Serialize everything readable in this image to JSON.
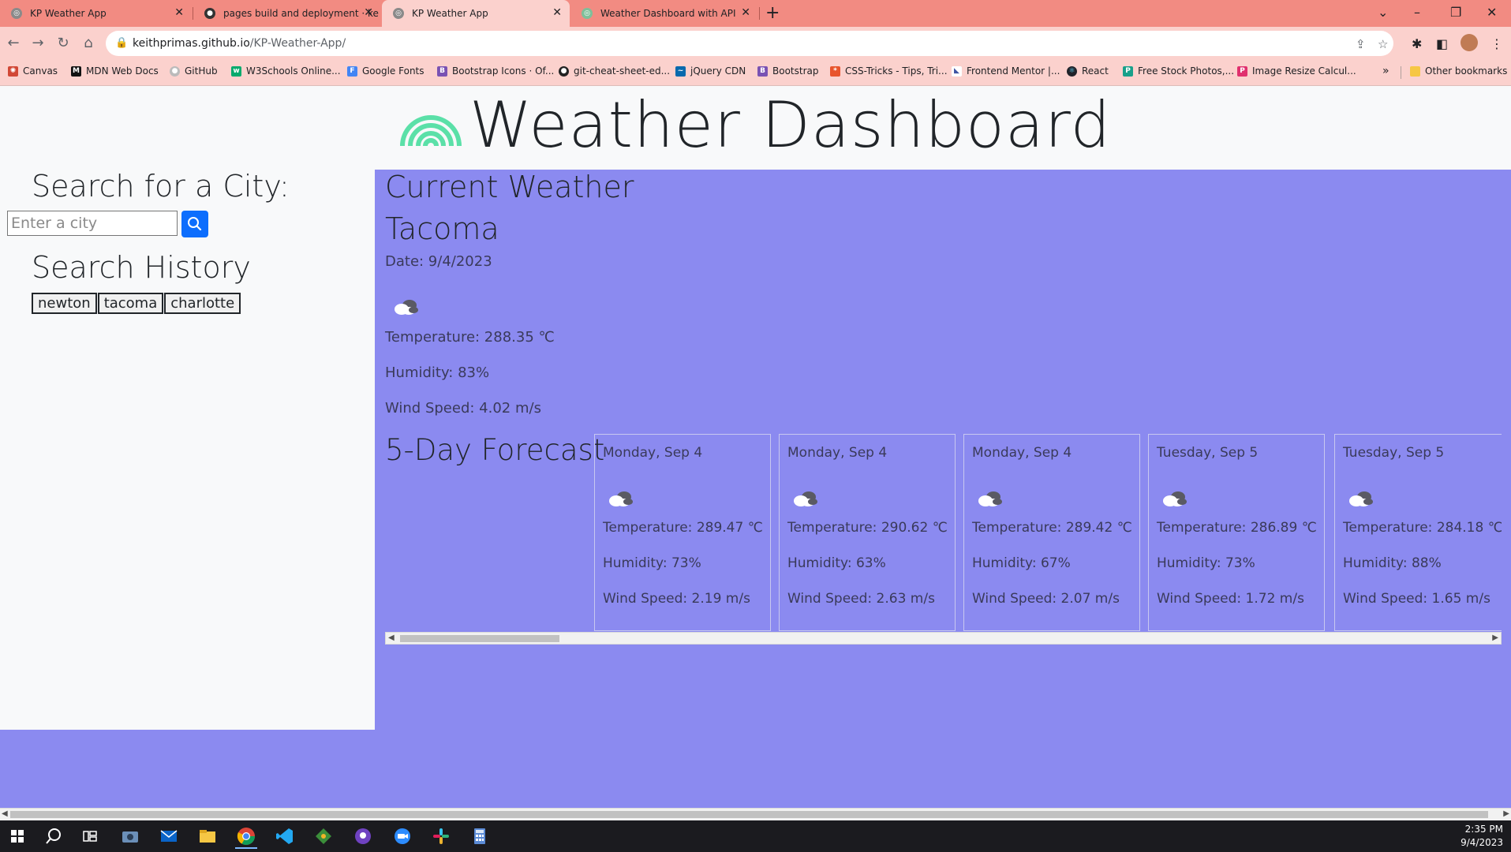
{
  "browser": {
    "tabs": [
      {
        "title": "KP Weather App",
        "active": false
      },
      {
        "title": "pages build and deployment · ke",
        "active": false
      },
      {
        "title": "KP Weather App",
        "active": true
      },
      {
        "title": "Weather Dashboard with API",
        "active": false
      }
    ],
    "address": {
      "host": "keithprimas.github.io",
      "path": "/KP-Weather-App/"
    },
    "bookmarks": [
      "Canvas",
      "MDN Web Docs",
      "GitHub",
      "W3Schools Online...",
      "Google Fonts",
      "Bootstrap Icons · Of...",
      "git-cheat-sheet-ed...",
      "jQuery CDN",
      "Bootstrap",
      "CSS-Tricks - Tips, Tri...",
      "Frontend Mentor |...",
      "React",
      "Free Stock Photos,...",
      "Image Resize Calcul..."
    ],
    "other_bookmarks": "Other bookmarks",
    "colors": {
      "tab_strip": "#f28b82",
      "toolbar": "#fbd1cd"
    }
  },
  "page": {
    "title": "Weather Dashboard",
    "search": {
      "heading": "Search for a City:",
      "placeholder": "Enter a city"
    },
    "history": {
      "heading": "Search History",
      "items": [
        "newton",
        "tacoma",
        "charlotte"
      ]
    },
    "current": {
      "heading": "Current Weather",
      "city": "Tacoma",
      "date": "Date: 9/4/2023",
      "icon": "cloud-icon",
      "temperature": "Temperature: 288.35 ℃",
      "humidity": "Humidity: 83%",
      "wind": "Wind Speed: 4.02 m/s"
    },
    "forecast": {
      "heading": "5-Day Forecast",
      "days": [
        {
          "date": "Monday, Sep 4",
          "temperature": "Temperature: 289.47 ℃",
          "humidity": "Humidity: 73%",
          "wind": "Wind Speed: 2.19 m/s"
        },
        {
          "date": "Monday, Sep 4",
          "temperature": "Temperature: 290.62 ℃",
          "humidity": "Humidity: 63%",
          "wind": "Wind Speed: 2.63 m/s"
        },
        {
          "date": "Monday, Sep 4",
          "temperature": "Temperature: 289.42 ℃",
          "humidity": "Humidity: 67%",
          "wind": "Wind Speed: 2.07 m/s"
        },
        {
          "date": "Tuesday, Sep 5",
          "temperature": "Temperature: 286.89 ℃",
          "humidity": "Humidity: 73%",
          "wind": "Wind Speed: 1.72 m/s"
        },
        {
          "date": "Tuesday, Sep 5",
          "temperature": "Temperature: 284.18 ℃",
          "humidity": "Humidity: 88%",
          "wind": "Wind Speed: 1.65 m/s"
        }
      ]
    },
    "colors": {
      "panel": "#8b8af0",
      "search_button": "#0d6efd",
      "logo": "#5be0a8"
    }
  },
  "taskbar": {
    "time": "2:35 PM",
    "date": "9/4/2023"
  }
}
